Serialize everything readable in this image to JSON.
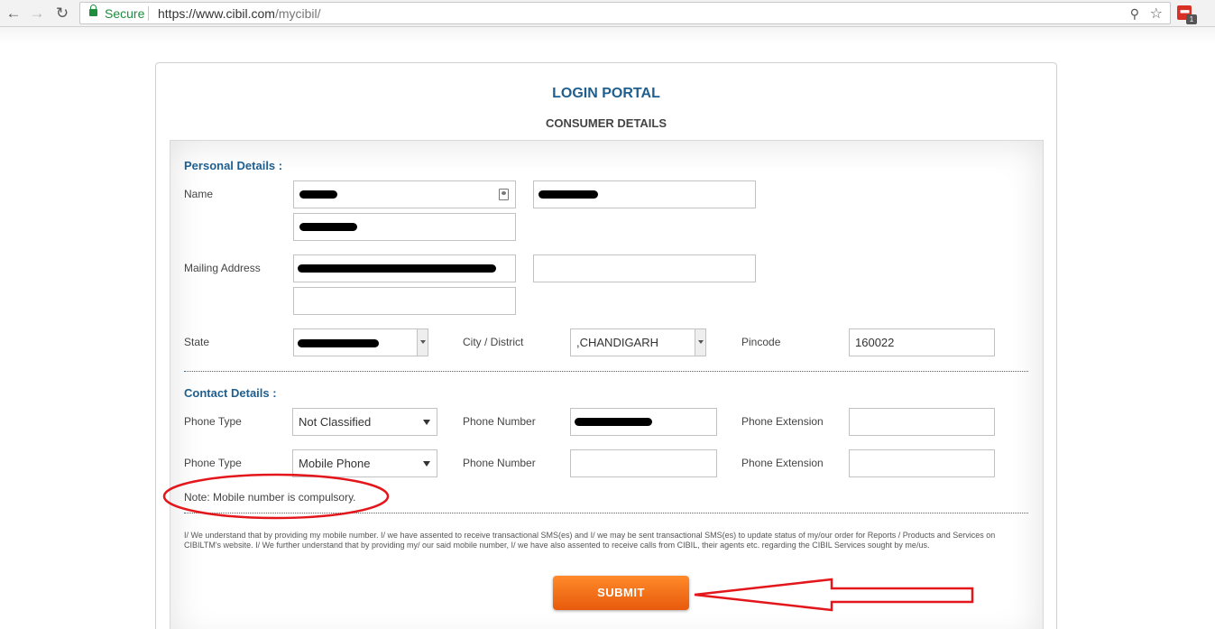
{
  "browser": {
    "secure_label": "Secure",
    "url_host": "https://www.cibil.com",
    "url_path": "/mycibil/",
    "extension_badge": "1",
    "icons": [
      "back-arrow-icon",
      "forward-arrow-icon",
      "reload-icon",
      "lock-icon",
      "key-icon",
      "star-icon",
      "extension-icon"
    ]
  },
  "portal": {
    "title": "LOGIN PORTAL",
    "subtitle": "CONSUMER DETAILS"
  },
  "personal": {
    "heading": "Personal Details :",
    "name_label": "Name",
    "mailing_label": "Mailing Address",
    "state_label": "State",
    "city_label": "City / District",
    "city_value": ",CHANDIGARH",
    "pincode_label": "Pincode",
    "pincode_value": "160022"
  },
  "contact": {
    "heading": "Contact Details :",
    "rows": [
      {
        "phone_type_label": "Phone Type",
        "phone_type_value": "Not Classified",
        "phone_number_label": "Phone Number",
        "phone_extension_label": "Phone Extension"
      },
      {
        "phone_type_label": "Phone Type",
        "phone_type_value": "Mobile Phone",
        "phone_number_label": "Phone Number",
        "phone_extension_label": "Phone Extension"
      }
    ],
    "note": "Note: Mobile number is compulsory."
  },
  "disclaimer": "I/ We understand that by providing my mobile number. I/ we have assented to receive transactional SMS(es) and I/ we may be sent transactional SMS(es) to update status of my/our order for Reports / Products and Services on CIBILTM's website. I/ We further understand that by providing my/ our said mobile number, I/ we have also assented to receive calls from CIBIL, their agents etc. regarding the CIBIL Services sought by me/us.",
  "submit_label": "SUBMIT",
  "colors": {
    "heading_blue": "#1f5f8f",
    "submit_orange": "#f26c1a",
    "annotation_red": "#e3161b",
    "secure_green": "#1e8e3e"
  }
}
